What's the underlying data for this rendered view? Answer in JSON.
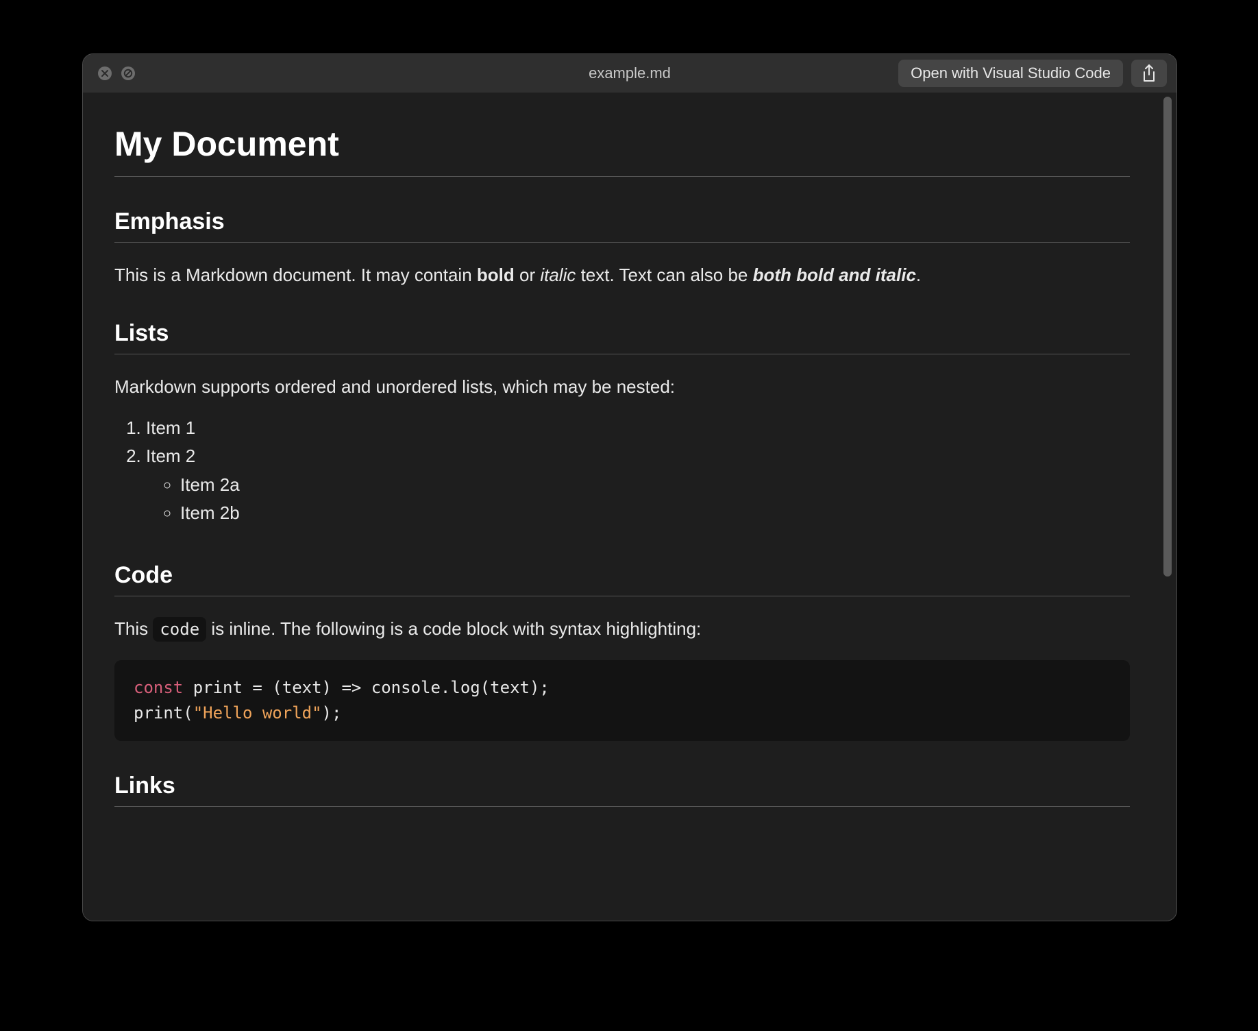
{
  "titlebar": {
    "filename": "example.md",
    "open_button": "Open with Visual Studio Code"
  },
  "doc": {
    "h1": "My Document",
    "sections": {
      "emphasis": {
        "heading": "Emphasis",
        "p_parts": {
          "t1": "This is a Markdown document. It may contain ",
          "bold": "bold",
          "t2": " or ",
          "italic": "italic",
          "t3": " text. Text can also be ",
          "bolditalic": "both bold and italic",
          "t4": "."
        }
      },
      "lists": {
        "heading": "Lists",
        "intro": "Markdown supports ordered and unordered lists, which may be nested:",
        "items": {
          "i1": "Item 1",
          "i2": "Item 2",
          "i2a": "Item 2a",
          "i2b": "Item 2b"
        }
      },
      "code": {
        "heading": "Code",
        "inline_parts": {
          "t1": "This ",
          "code": "code",
          "t2": " is inline. The following is a code block with syntax highlighting:"
        },
        "block": {
          "line1": {
            "kw": "const",
            "rest": " print = (text) => console.log(text);"
          },
          "line2": {
            "pre": "print(",
            "str": "\"Hello world\"",
            "post": ");"
          }
        }
      },
      "links": {
        "heading": "Links"
      }
    }
  }
}
